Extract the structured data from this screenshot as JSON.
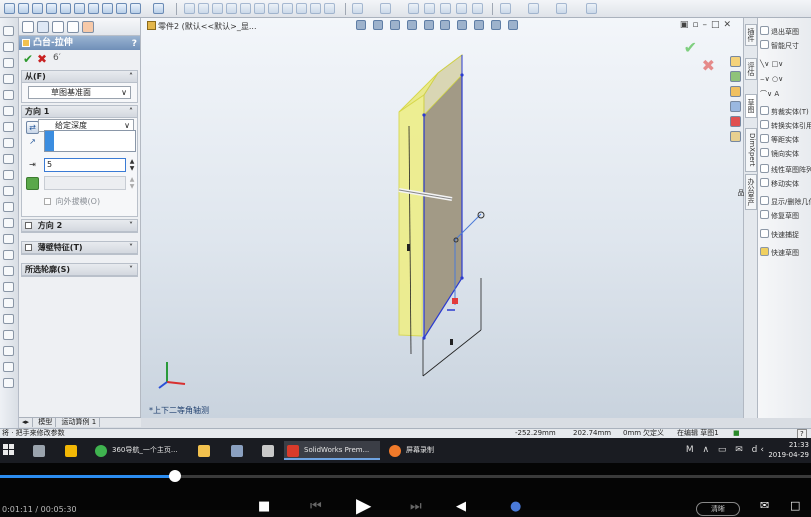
{
  "property_manager": {
    "title": "凸台-拉伸",
    "help": "?",
    "from_group": {
      "label": "从(F)",
      "value": "草图基准面"
    },
    "direction1": {
      "label": "方向 1",
      "end_condition": "给定深度",
      "depth_value": "5",
      "draft_label": "向外拔模(O)"
    },
    "direction2_label": "方向 2",
    "thin_feature_label": "薄壁特征(T)",
    "selected_contours_label": "所选轮廓(S)",
    "bottom_tabs": [
      "模型",
      "运动算例 1"
    ]
  },
  "viewport": {
    "tree_label": "零件2 (默认<<默认>_显...",
    "view_label": "*上下二等角轴测"
  },
  "task_tabs": [
    "插件",
    "评估",
    "DimXpert",
    "草图",
    "办公室产品"
  ],
  "command_manager": {
    "items": [
      {
        "label": "退出草图",
        "dim": false
      },
      {
        "label": "智能尺寸",
        "dim": false
      },
      {
        "label": "剪裁实体(T)",
        "dim": false
      },
      {
        "label": "转换实体引用",
        "dim": false
      },
      {
        "label": "等距实体",
        "dim": false
      },
      {
        "label": "镜向实体",
        "dim": false
      },
      {
        "label": "线性草图阵列",
        "dim": false
      },
      {
        "label": "移动实体",
        "dim": false
      },
      {
        "label": "显示/删除几何关系",
        "dim": false
      },
      {
        "label": "修复草图",
        "dim": false
      },
      {
        "label": "快速捕捉",
        "dim": false
      },
      {
        "label": "快速草图",
        "dim": false
      }
    ]
  },
  "status_bar": {
    "message": "将 · 把手来修改参数",
    "x": "-252.29mm",
    "y": "202.74mm",
    "z": "0mm",
    "state": "欠定义",
    "editing": "在编辑 草图1"
  },
  "taskbar": {
    "items": [
      {
        "label": "360导航_一个主页...",
        "color": "#3fb34f",
        "active": false
      },
      {
        "label": "SolidWorks Prem...",
        "color": "#d93b2b",
        "active": true
      },
      {
        "label": "屏幕录制",
        "color": "#f07a2a",
        "active": false
      }
    ],
    "time": "21:33",
    "date": "2019-04-29"
  },
  "player": {
    "progress_fraction": 0.216,
    "time_text": "0:01:11 / 00:05:30",
    "quality_label": "清晰"
  },
  "colors": {
    "accent": "#2b8cf0",
    "part_face": "#a29a86",
    "selection_yellow": "#e7e75a"
  }
}
